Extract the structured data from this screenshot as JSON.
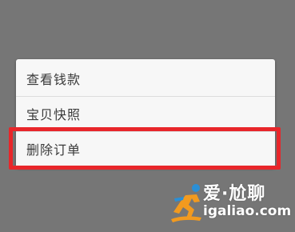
{
  "context_menu": {
    "items": [
      {
        "label": "查看钱款"
      },
      {
        "label": "宝贝快照"
      },
      {
        "label": "删除订单"
      }
    ],
    "highlighted_item": "删除订单"
  },
  "colors": {
    "overlay_background": "#767676",
    "menu_background": "#f7f7f7",
    "highlight_border": "#e8262a",
    "watermark_orange": "#f29a1f",
    "watermark_blue": "#2a8fd6"
  },
  "watermark": {
    "title": "爱·尬聊",
    "domain": "igaliao.com",
    "logo_icon": "runner-logo-icon"
  }
}
